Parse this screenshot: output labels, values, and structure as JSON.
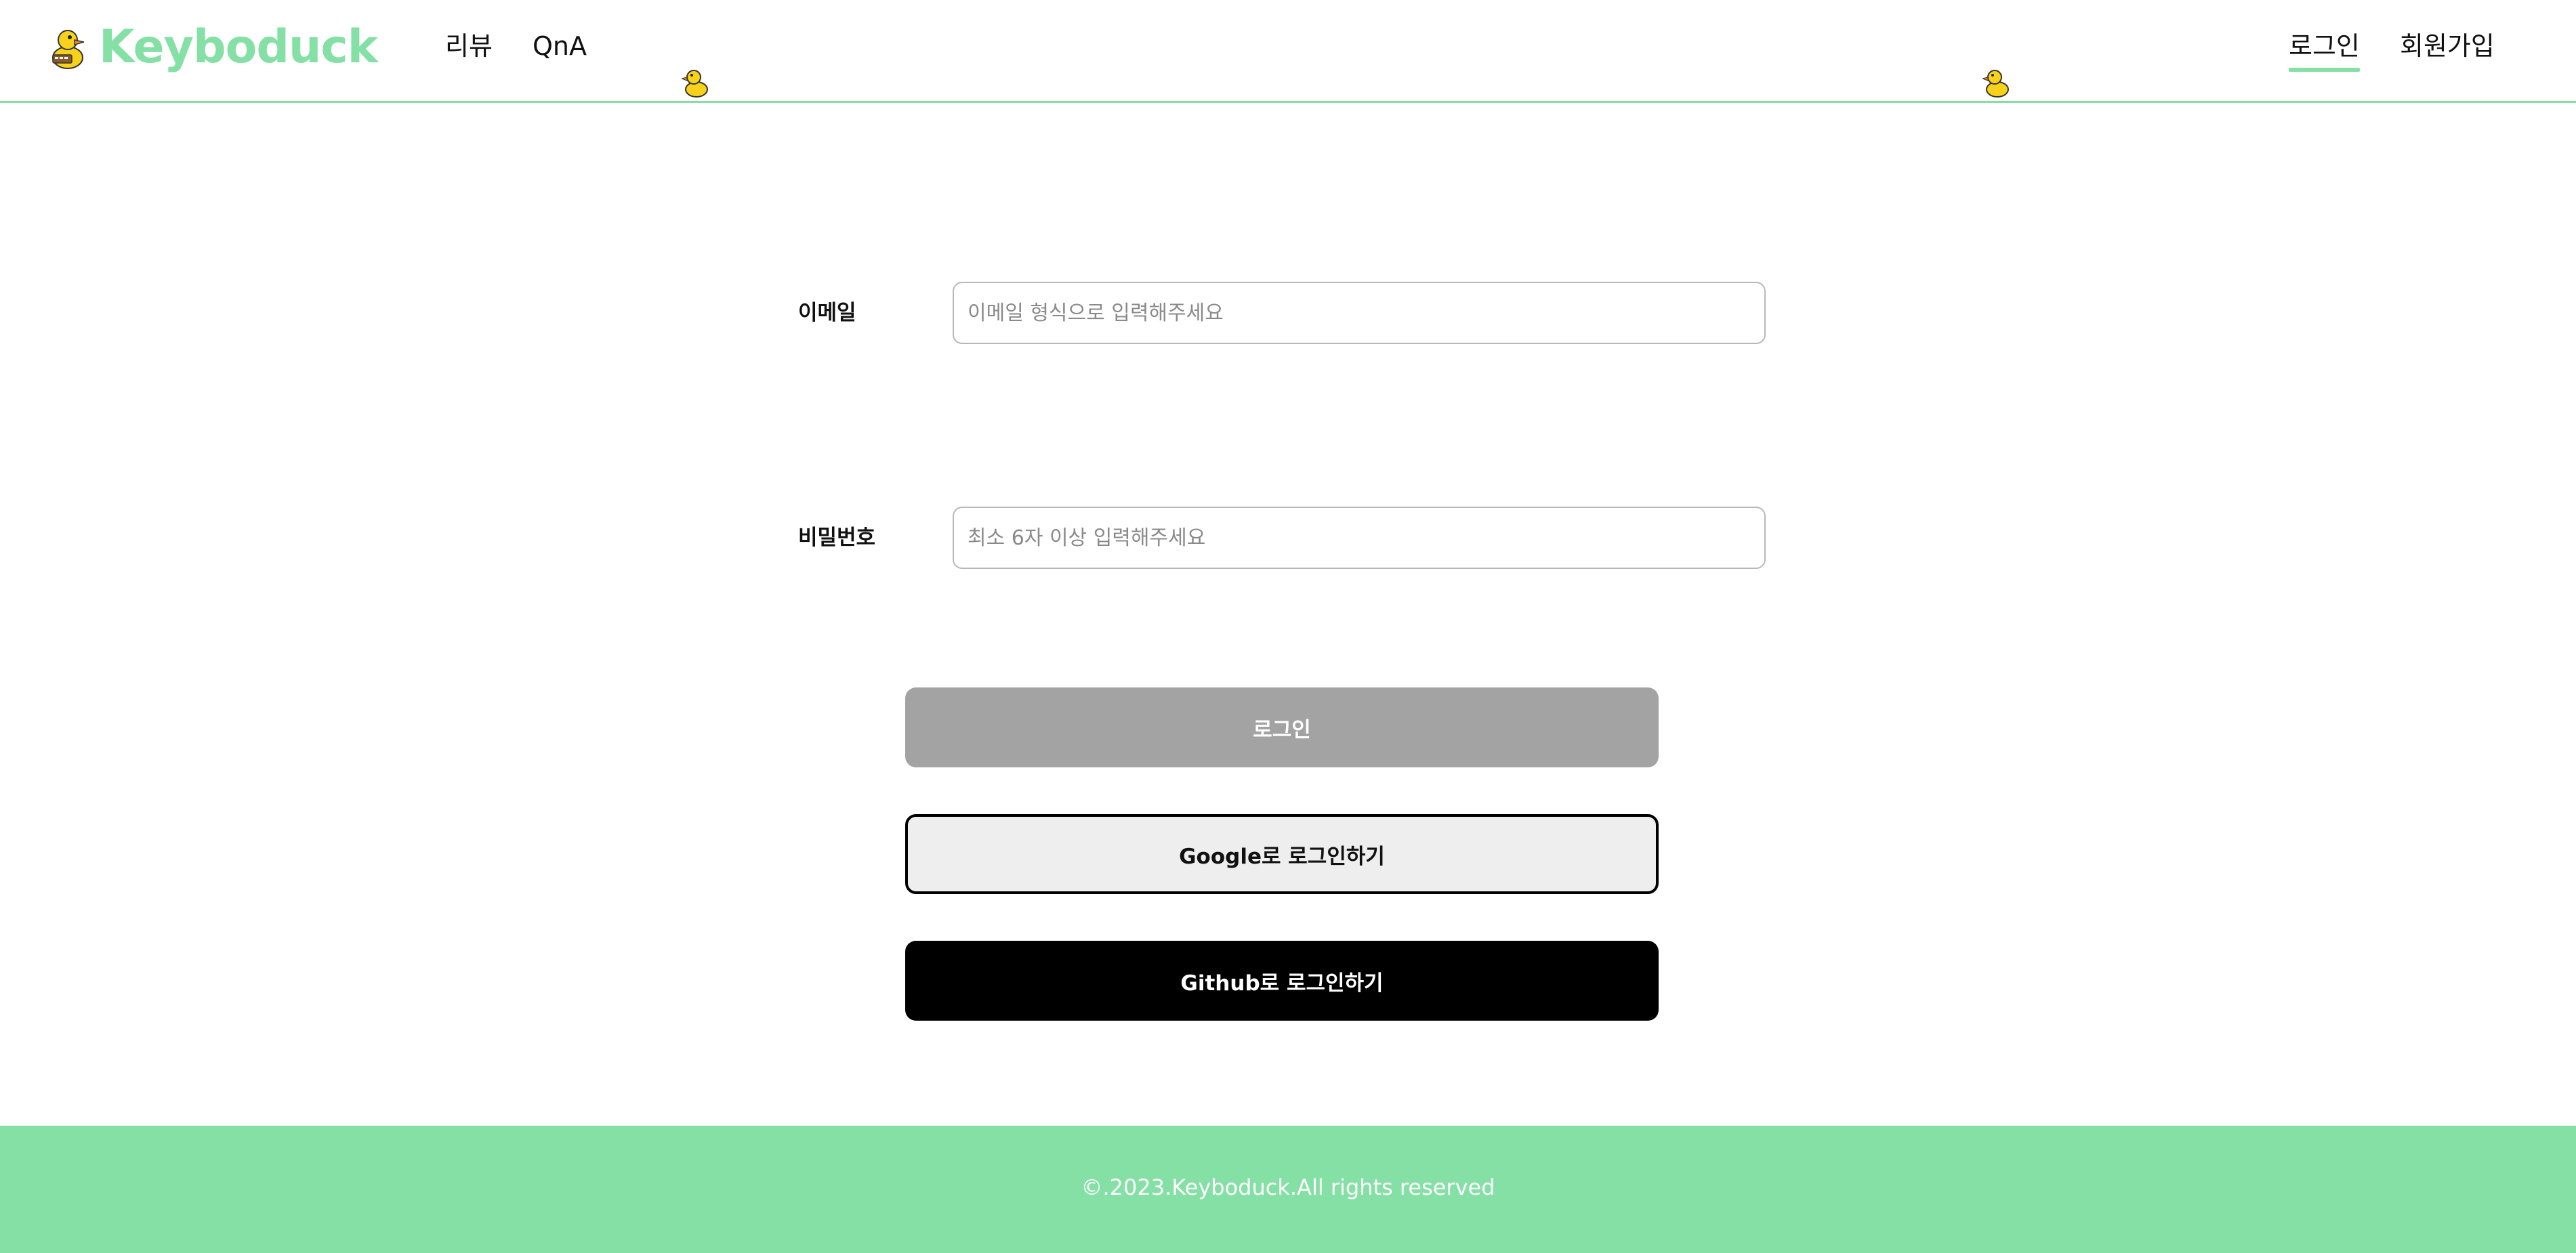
{
  "brand": {
    "name": "Keyboduck",
    "icon": "duck-logo-icon",
    "color": "#84e0a5"
  },
  "nav": {
    "left": [
      {
        "label": "리뷰"
      },
      {
        "label": "QnA"
      }
    ],
    "right": [
      {
        "label": "로그인",
        "active": true
      },
      {
        "label": "회원가입",
        "active": false
      }
    ]
  },
  "form": {
    "email": {
      "label": "이메일",
      "placeholder": "이메일 형식으로 입력해주세요",
      "value": ""
    },
    "password": {
      "label": "비밀번호",
      "placeholder": "최소 6자 이상 입력해주세요",
      "value": ""
    }
  },
  "buttons": {
    "login": "로그인",
    "google": "Google로 로그인하기",
    "github": "Github로 로그인하기"
  },
  "footer": {
    "text": "©.2023.Keyboduck.All rights reserved"
  },
  "colors": {
    "accent": "#84e0a5",
    "disabled_button": "#a3a3a3",
    "google_button": "#eeeeee",
    "github_button": "#000000"
  }
}
